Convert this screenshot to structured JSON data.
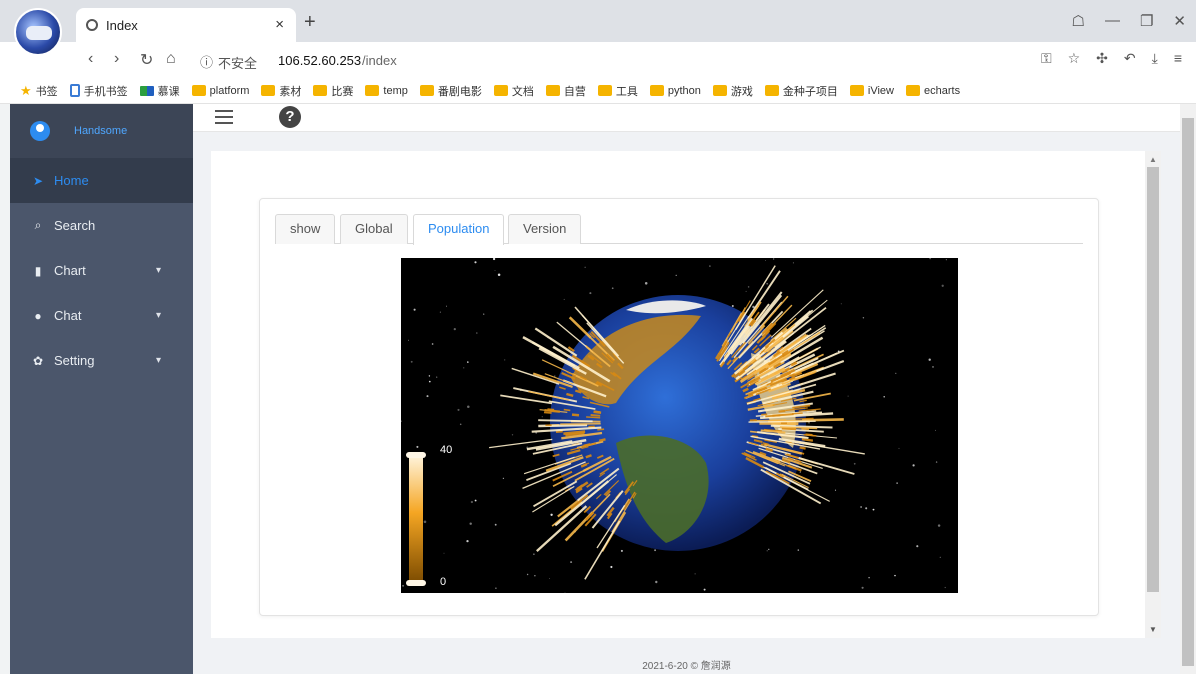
{
  "browser": {
    "tab_title": "Index",
    "tab_close": "×",
    "new_tab": "+",
    "security_label": "不安全",
    "url_host": "106.52.60.253",
    "url_path": "/index",
    "bookmarks": [
      {
        "label": "书签",
        "icon": "star-icon"
      },
      {
        "label": "手机书签",
        "icon": "mobile-icon"
      },
      {
        "label": "慕课",
        "icon": "flag-icon"
      },
      {
        "label": "platform",
        "icon": "folder-icon"
      },
      {
        "label": "素材",
        "icon": "folder-icon"
      },
      {
        "label": "比赛",
        "icon": "folder-icon"
      },
      {
        "label": "temp",
        "icon": "folder-icon"
      },
      {
        "label": "番剧电影",
        "icon": "folder-icon"
      },
      {
        "label": "文档",
        "icon": "folder-icon"
      },
      {
        "label": "自营",
        "icon": "folder-icon"
      },
      {
        "label": "工具",
        "icon": "folder-icon"
      },
      {
        "label": "python",
        "icon": "folder-icon"
      },
      {
        "label": "游戏",
        "icon": "folder-icon"
      },
      {
        "label": "金种子项目",
        "icon": "folder-icon"
      },
      {
        "label": "iView",
        "icon": "folder-icon"
      },
      {
        "label": "echarts",
        "icon": "folder-icon"
      }
    ]
  },
  "sidebar": {
    "user_name": "Handsome",
    "items": [
      {
        "label": "Home",
        "icon": "rocket-icon",
        "active": true,
        "has_submenu": false
      },
      {
        "label": "Search",
        "icon": "search-icon",
        "active": false,
        "has_submenu": false
      },
      {
        "label": "Chart",
        "icon": "bar-chart-icon",
        "active": false,
        "has_submenu": true
      },
      {
        "label": "Chat",
        "icon": "chat-bubble-icon",
        "active": false,
        "has_submenu": true
      },
      {
        "label": "Setting",
        "icon": "gear-icon",
        "active": false,
        "has_submenu": true
      }
    ]
  },
  "tabs": [
    {
      "label": "show",
      "active": false
    },
    {
      "label": "Global",
      "active": false
    },
    {
      "label": "Population",
      "active": true
    },
    {
      "label": "Version",
      "active": false
    }
  ],
  "visual_map": {
    "max_label": "40",
    "min_label": "0"
  },
  "footer": "2021-6-20 © 詹润源",
  "colors": {
    "accent": "#2d8cf0",
    "sidebar": "#4b566b",
    "bar": "#f5a623"
  }
}
